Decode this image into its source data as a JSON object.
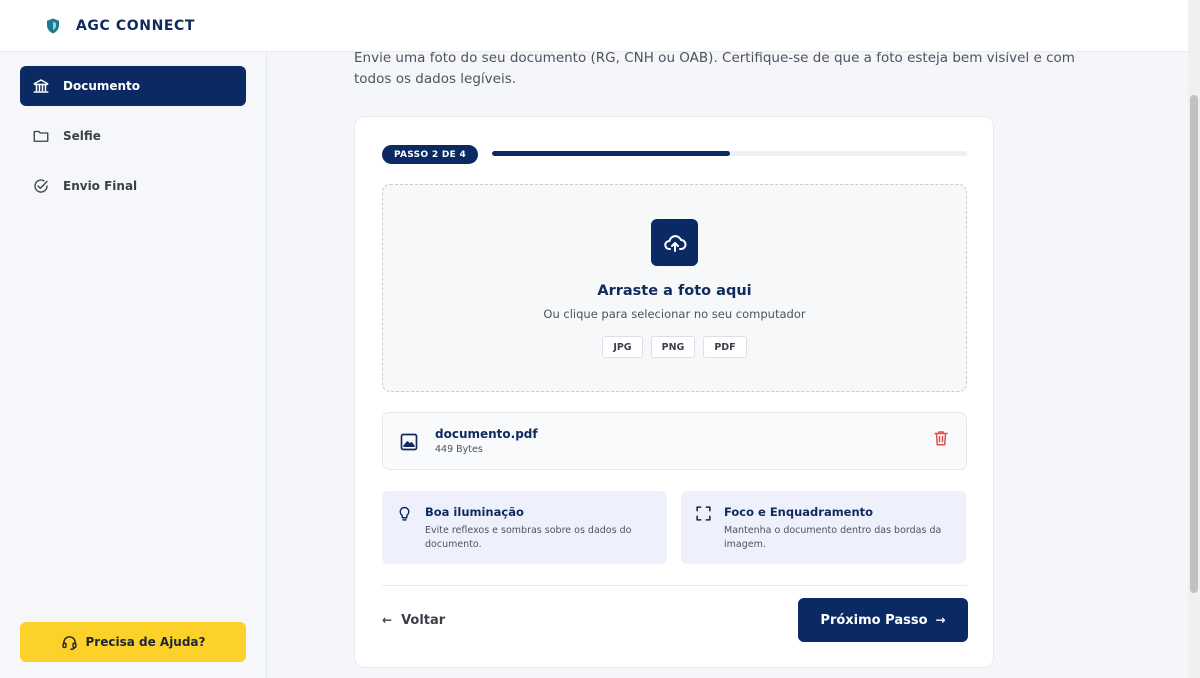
{
  "header": {
    "brand": "AGC CONNECT",
    "logo_icon": "shield-logo-icon"
  },
  "sidebar": {
    "items": [
      {
        "label": "Documento",
        "icon": "bank-icon",
        "active": true
      },
      {
        "label": "Selfie",
        "icon": "folder-icon",
        "active": false
      },
      {
        "label": "Envio Final",
        "icon": "check-circle-icon",
        "active": false
      }
    ],
    "help_label": "Precisa de Ajuda?"
  },
  "main": {
    "intro": "Envie uma foto do seu documento (RG, CNH ou OAB). Certifique-se de que a foto esteja bem visível e com todos os dados legíveis.",
    "step": {
      "label": "PASSO 2 DE 4",
      "progress_percent": 50
    },
    "dropzone": {
      "title": "Arraste a foto aqui",
      "subtitle": "Ou clique para selecionar no seu computador",
      "formats": [
        "JPG",
        "PNG",
        "PDF"
      ]
    },
    "file": {
      "name": "documento.pdf",
      "size": "449 Bytes"
    },
    "tips": [
      {
        "title": "Boa iluminação",
        "text": "Evite reflexos e sombras sobre os dados do documento.",
        "icon": "lightbulb-icon"
      },
      {
        "title": "Foco e Enquadramento",
        "text": "Mantenha o documento dentro das bordas da imagem.",
        "icon": "focus-frame-icon"
      }
    ],
    "back_label": "Voltar",
    "next_label": "Próximo Passo"
  },
  "colors": {
    "primary": "#0b2a63",
    "accent": "#fcd12a",
    "danger": "#e05252",
    "tip_bg": "#eef1fb"
  }
}
